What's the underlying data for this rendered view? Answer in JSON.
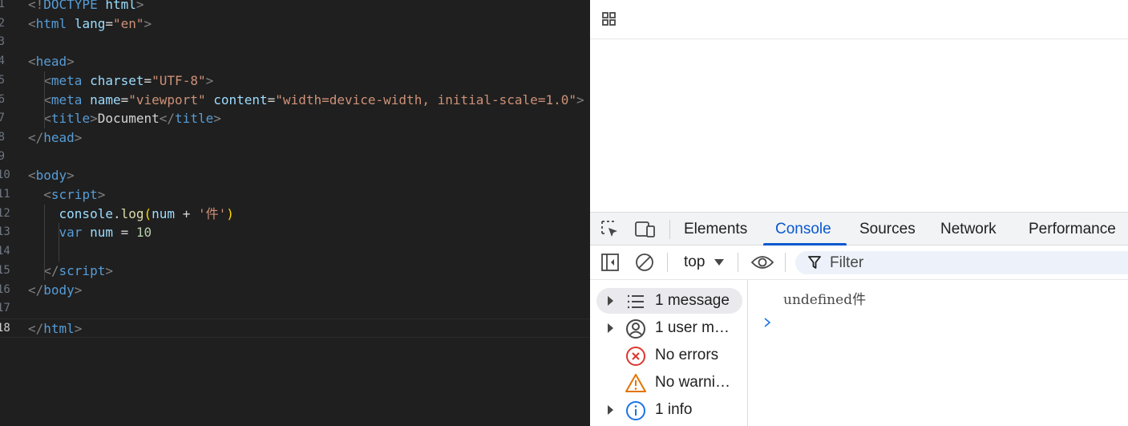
{
  "editor": {
    "lines": [
      {
        "num": "1",
        "tokens": [
          {
            "t": "br",
            "v": "<!"
          },
          {
            "t": "tag",
            "v": "DOCTYPE"
          },
          {
            "t": "txt",
            "v": " "
          },
          {
            "t": "attr",
            "v": "html"
          },
          {
            "t": "br",
            "v": ">"
          }
        ]
      },
      {
        "num": "2",
        "tokens": [
          {
            "t": "br",
            "v": "<"
          },
          {
            "t": "tag",
            "v": "html"
          },
          {
            "t": "txt",
            "v": " "
          },
          {
            "t": "attr",
            "v": "lang"
          },
          {
            "t": "txt",
            "v": "="
          },
          {
            "t": "str",
            "v": "\"en\""
          },
          {
            "t": "br",
            "v": ">"
          }
        ]
      },
      {
        "num": "3",
        "tokens": []
      },
      {
        "num": "4",
        "tokens": [
          {
            "t": "br",
            "v": "<"
          },
          {
            "t": "tag",
            "v": "head"
          },
          {
            "t": "br",
            "v": ">"
          }
        ]
      },
      {
        "num": "5",
        "tokens": [
          {
            "t": "txt",
            "v": "  "
          },
          {
            "t": "br",
            "v": "<"
          },
          {
            "t": "tag",
            "v": "meta"
          },
          {
            "t": "txt",
            "v": " "
          },
          {
            "t": "attr",
            "v": "charset"
          },
          {
            "t": "txt",
            "v": "="
          },
          {
            "t": "str",
            "v": "\"UTF-8\""
          },
          {
            "t": "br",
            "v": ">"
          }
        ]
      },
      {
        "num": "6",
        "tokens": [
          {
            "t": "txt",
            "v": "  "
          },
          {
            "t": "br",
            "v": "<"
          },
          {
            "t": "tag",
            "v": "meta"
          },
          {
            "t": "txt",
            "v": " "
          },
          {
            "t": "attr",
            "v": "name"
          },
          {
            "t": "txt",
            "v": "="
          },
          {
            "t": "str",
            "v": "\"viewport\""
          },
          {
            "t": "txt",
            "v": " "
          },
          {
            "t": "attr",
            "v": "content"
          },
          {
            "t": "txt",
            "v": "="
          },
          {
            "t": "str",
            "v": "\"width=device-width, initial-scale=1.0\""
          },
          {
            "t": "br",
            "v": ">"
          }
        ]
      },
      {
        "num": "7",
        "tokens": [
          {
            "t": "txt",
            "v": "  "
          },
          {
            "t": "br",
            "v": "<"
          },
          {
            "t": "tag",
            "v": "title"
          },
          {
            "t": "br",
            "v": ">"
          },
          {
            "t": "txt",
            "v": "Document"
          },
          {
            "t": "br",
            "v": "</"
          },
          {
            "t": "tag",
            "v": "title"
          },
          {
            "t": "br",
            "v": ">"
          }
        ]
      },
      {
        "num": "8",
        "tokens": [
          {
            "t": "br",
            "v": "</"
          },
          {
            "t": "tag",
            "v": "head"
          },
          {
            "t": "br",
            "v": ">"
          }
        ]
      },
      {
        "num": "9",
        "tokens": []
      },
      {
        "num": "10",
        "tokens": [
          {
            "t": "br",
            "v": "<"
          },
          {
            "t": "tag",
            "v": "body"
          },
          {
            "t": "br",
            "v": ">"
          }
        ]
      },
      {
        "num": "11",
        "tokens": [
          {
            "t": "txt",
            "v": "  "
          },
          {
            "t": "br",
            "v": "<"
          },
          {
            "t": "tag",
            "v": "script"
          },
          {
            "t": "br",
            "v": ">"
          }
        ]
      },
      {
        "num": "12",
        "tokens": [
          {
            "t": "txt",
            "v": "    "
          },
          {
            "t": "var",
            "v": "console"
          },
          {
            "t": "op",
            "v": "."
          },
          {
            "t": "fn",
            "v": "log"
          },
          {
            "t": "paren",
            "v": "("
          },
          {
            "t": "var",
            "v": "num"
          },
          {
            "t": "op",
            "v": " + "
          },
          {
            "t": "str",
            "v": "'件'"
          },
          {
            "t": "paren",
            "v": ")"
          }
        ]
      },
      {
        "num": "13",
        "tokens": [
          {
            "t": "txt",
            "v": "    "
          },
          {
            "t": "kw",
            "v": "var"
          },
          {
            "t": "txt",
            "v": " "
          },
          {
            "t": "var",
            "v": "num"
          },
          {
            "t": "op",
            "v": " = "
          },
          {
            "t": "num",
            "v": "10"
          }
        ]
      },
      {
        "num": "14",
        "tokens": []
      },
      {
        "num": "15",
        "tokens": [
          {
            "t": "txt",
            "v": "  "
          },
          {
            "t": "br",
            "v": "</"
          },
          {
            "t": "tag",
            "v": "script"
          },
          {
            "t": "br",
            "v": ">"
          }
        ]
      },
      {
        "num": "16",
        "tokens": [
          {
            "t": "br",
            "v": "</"
          },
          {
            "t": "tag",
            "v": "body"
          },
          {
            "t": "br",
            "v": ">"
          }
        ]
      },
      {
        "num": "17",
        "tokens": []
      },
      {
        "num": "18",
        "tokens": [
          {
            "t": "br",
            "v": "</"
          },
          {
            "t": "tag",
            "v": "html"
          },
          {
            "t": "br",
            "v": ">"
          }
        ]
      }
    ],
    "active_line": "18"
  },
  "devtools": {
    "tabs": [
      {
        "label": "Elements"
      },
      {
        "label": "Console",
        "active": true
      },
      {
        "label": "Sources"
      },
      {
        "label": "Network"
      },
      {
        "label": "Performance"
      }
    ],
    "context_selector": "top",
    "filter_placeholder": "Filter",
    "sidebar": [
      {
        "label": "1 message",
        "icon": "list-icon",
        "expandable": true,
        "selected": true
      },
      {
        "label": "1 user m…",
        "icon": "user-icon",
        "expandable": true
      },
      {
        "label": "No errors",
        "icon": "error-icon",
        "expandable": false
      },
      {
        "label": "No warni…",
        "icon": "warning-icon",
        "expandable": false
      },
      {
        "label": "1 info",
        "icon": "info-icon",
        "expandable": true
      }
    ],
    "console_log": "undefined件"
  },
  "colors": {
    "editor_bg": "#1f1f1f",
    "accent": "#0b57d0",
    "error": "#dc362e",
    "warning": "#e37400",
    "info": "#1a73e8"
  }
}
